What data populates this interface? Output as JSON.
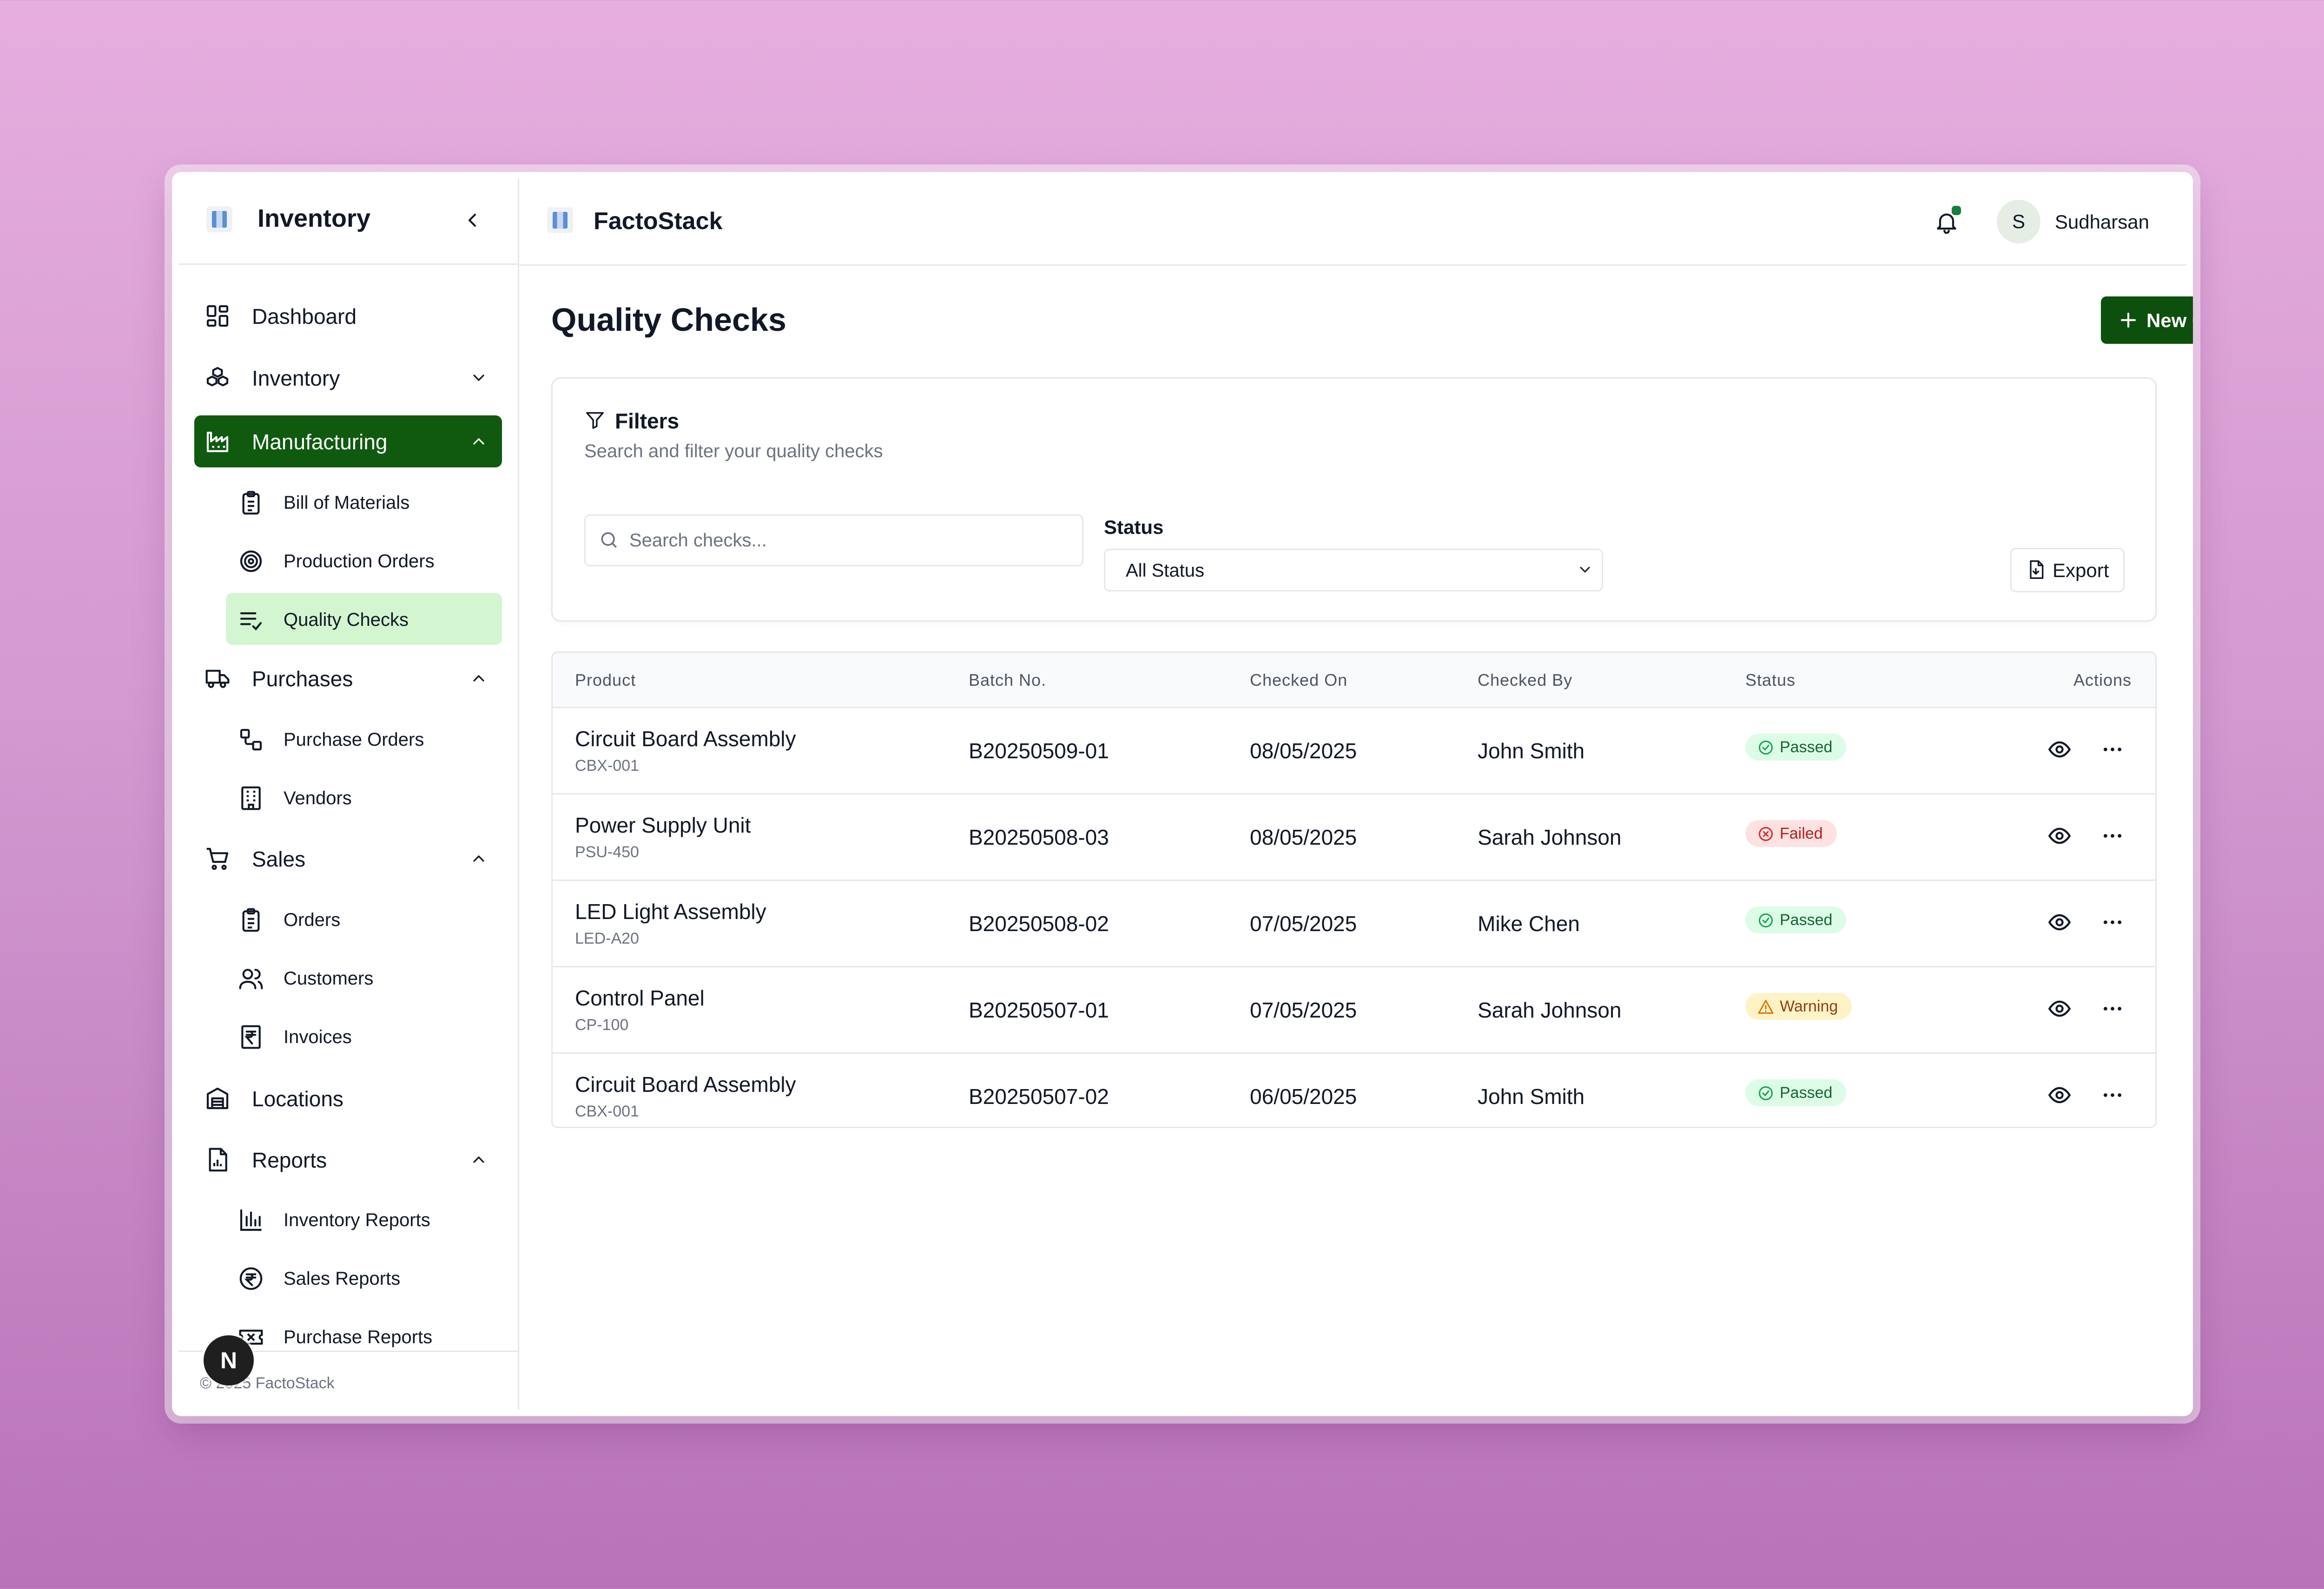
{
  "sidebar": {
    "title": "Inventory",
    "items": [
      {
        "label": "Dashboard"
      },
      {
        "label": "Inventory"
      },
      {
        "label": "Manufacturing"
      },
      {
        "label": "Purchases"
      },
      {
        "label": "Sales"
      },
      {
        "label": "Locations"
      },
      {
        "label": "Reports"
      }
    ],
    "manufacturing_sub": [
      {
        "label": "Bill of Materials"
      },
      {
        "label": "Production Orders"
      },
      {
        "label": "Quality Checks"
      }
    ],
    "purchases_sub": [
      {
        "label": "Purchase Orders"
      },
      {
        "label": "Vendors"
      }
    ],
    "sales_sub": [
      {
        "label": "Orders"
      },
      {
        "label": "Customers"
      },
      {
        "label": "Invoices"
      }
    ],
    "reports_sub": [
      {
        "label": "Inventory Reports"
      },
      {
        "label": "Sales Reports"
      },
      {
        "label": "Purchase Reports"
      }
    ],
    "footer": "© 2025 FactoStack",
    "badge": "N"
  },
  "topbar": {
    "app_name": "FactoStack",
    "user_initial": "S",
    "user_name": "Sudharsan"
  },
  "page": {
    "title": "Quality Checks",
    "new_button": "New Quality Check"
  },
  "filters": {
    "title": "Filters",
    "subtitle": "Search and filter your quality checks",
    "search_placeholder": "Search checks...",
    "status_label": "Status",
    "status_value": "All Status",
    "export_label": "Export"
  },
  "table": {
    "headers": [
      "Product",
      "Batch No.",
      "Checked On",
      "Checked By",
      "Status",
      "Actions"
    ],
    "rows": [
      {
        "product": "Circuit Board Assembly",
        "code": "CBX-001",
        "batch": "B20250509-01",
        "date": "08/05/2025",
        "by": "John Smith",
        "status": "Passed"
      },
      {
        "product": "Power Supply Unit",
        "code": "PSU-450",
        "batch": "B20250508-03",
        "date": "08/05/2025",
        "by": "Sarah Johnson",
        "status": "Failed"
      },
      {
        "product": "LED Light Assembly",
        "code": "LED-A20",
        "batch": "B20250508-02",
        "date": "07/05/2025",
        "by": "Mike Chen",
        "status": "Passed"
      },
      {
        "product": "Control Panel",
        "code": "CP-100",
        "batch": "B20250507-01",
        "date": "07/05/2025",
        "by": "Sarah Johnson",
        "status": "Warning"
      },
      {
        "product": "Circuit Board Assembly",
        "code": "CBX-001",
        "batch": "B20250507-02",
        "date": "06/05/2025",
        "by": "John Smith",
        "status": "Passed"
      }
    ]
  },
  "colors": {
    "accent": "#0f5a0f",
    "active_sub_bg": "#d3f5cf",
    "passed": "#166534",
    "failed": "#b91c1c",
    "warning": "#92400e"
  }
}
